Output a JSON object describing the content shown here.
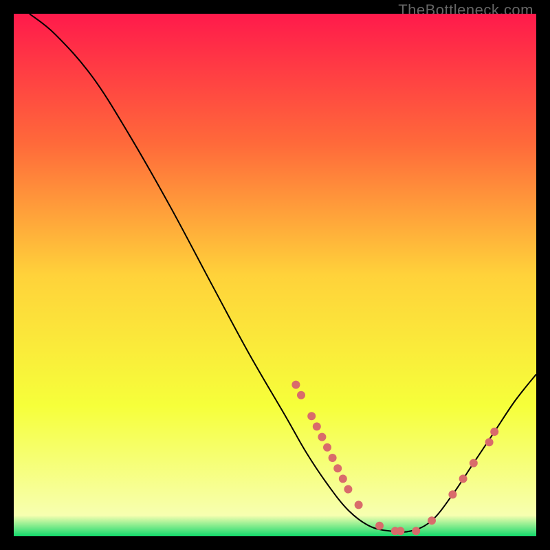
{
  "watermark": "TheBottleneck.com",
  "chart_data": {
    "type": "line",
    "title": "",
    "xlabel": "",
    "ylabel": "",
    "xlim": [
      0,
      100
    ],
    "ylim": [
      0,
      100
    ],
    "grid": false,
    "legend": false,
    "background_gradient": {
      "stops": [
        {
          "offset": 0,
          "color": "#ff1a4b"
        },
        {
          "offset": 25,
          "color": "#ff6a3a"
        },
        {
          "offset": 50,
          "color": "#ffd23a"
        },
        {
          "offset": 75,
          "color": "#f6ff3a"
        },
        {
          "offset": 96,
          "color": "#f7ffb0"
        },
        {
          "offset": 100,
          "color": "#12d96b"
        }
      ]
    },
    "curve": [
      {
        "x": 3,
        "y": 100
      },
      {
        "x": 8,
        "y": 96
      },
      {
        "x": 15,
        "y": 88
      },
      {
        "x": 22,
        "y": 77
      },
      {
        "x": 30,
        "y": 63
      },
      {
        "x": 38,
        "y": 48
      },
      {
        "x": 45,
        "y": 35
      },
      {
        "x": 52,
        "y": 23
      },
      {
        "x": 56,
        "y": 16
      },
      {
        "x": 60,
        "y": 10
      },
      {
        "x": 64,
        "y": 5
      },
      {
        "x": 68,
        "y": 2
      },
      {
        "x": 72,
        "y": 1
      },
      {
        "x": 76,
        "y": 1
      },
      {
        "x": 80,
        "y": 3
      },
      {
        "x": 84,
        "y": 8
      },
      {
        "x": 88,
        "y": 14
      },
      {
        "x": 92,
        "y": 20
      },
      {
        "x": 96,
        "y": 26
      },
      {
        "x": 100,
        "y": 31
      }
    ],
    "markers": [
      {
        "x": 54,
        "y": 29
      },
      {
        "x": 55,
        "y": 27
      },
      {
        "x": 57,
        "y": 23
      },
      {
        "x": 58,
        "y": 21
      },
      {
        "x": 59,
        "y": 19
      },
      {
        "x": 60,
        "y": 17
      },
      {
        "x": 61,
        "y": 15
      },
      {
        "x": 62,
        "y": 13
      },
      {
        "x": 63,
        "y": 11
      },
      {
        "x": 64,
        "y": 9
      },
      {
        "x": 66,
        "y": 6
      },
      {
        "x": 70,
        "y": 2
      },
      {
        "x": 73,
        "y": 1
      },
      {
        "x": 74,
        "y": 1
      },
      {
        "x": 77,
        "y": 1
      },
      {
        "x": 80,
        "y": 3
      },
      {
        "x": 84,
        "y": 8
      },
      {
        "x": 86,
        "y": 11
      },
      {
        "x": 88,
        "y": 14
      },
      {
        "x": 91,
        "y": 18
      },
      {
        "x": 92,
        "y": 20
      }
    ],
    "marker_style": {
      "color": "#d96b6b",
      "radius": 6
    },
    "curve_style": {
      "color": "#000000",
      "width": 2
    }
  }
}
